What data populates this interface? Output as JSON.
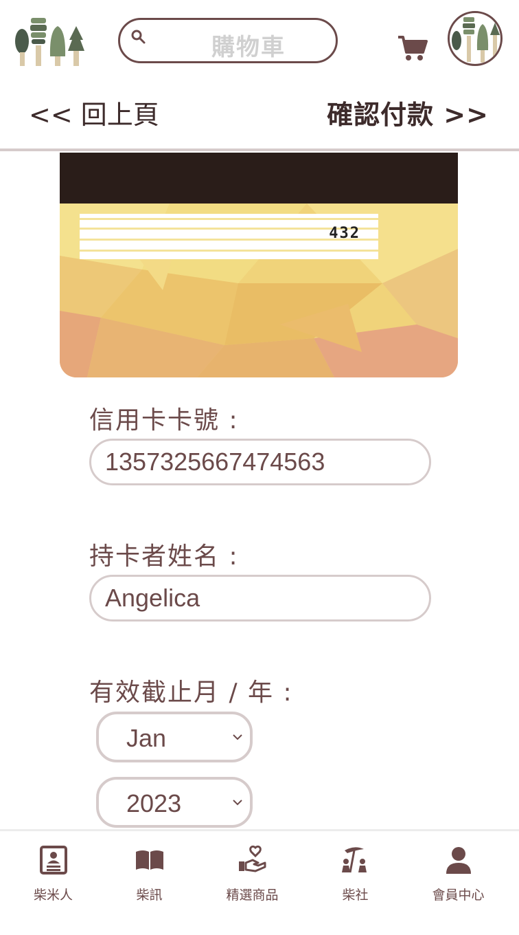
{
  "header": {
    "search_placeholder": "購物車",
    "icons": {
      "logo": "tree-logo",
      "search": "search-icon",
      "cart": "cart-icon",
      "avatar": "tree-avatar"
    }
  },
  "nav": {
    "back_label": "<< 回上頁",
    "confirm_label": "確認付款 >>"
  },
  "card": {
    "cvv": "432"
  },
  "form": {
    "card_number_label": "信用卡卡號 :",
    "card_number_value": "1357325667474563",
    "holder_label": "持卡者姓名 :",
    "holder_value": "Angelica",
    "expiry_label": "有效截止月 / 年 :",
    "expiry_month": "Jan",
    "expiry_year": "2023"
  },
  "bottom_nav": {
    "items": [
      {
        "label": "柴米人",
        "icon": "profile-card-icon"
      },
      {
        "label": "柴訊",
        "icon": "book-icon"
      },
      {
        "label": "精選商品",
        "icon": "hand-heart-icon"
      },
      {
        "label": "柴社",
        "icon": "community-icon"
      },
      {
        "label": "會員中心",
        "icon": "person-icon"
      }
    ]
  },
  "colors": {
    "primary": "#6b4a4a",
    "dark_text": "#3d2b2b",
    "border_light": "#d6cbcb",
    "card_stripe": "#2a1d19"
  }
}
